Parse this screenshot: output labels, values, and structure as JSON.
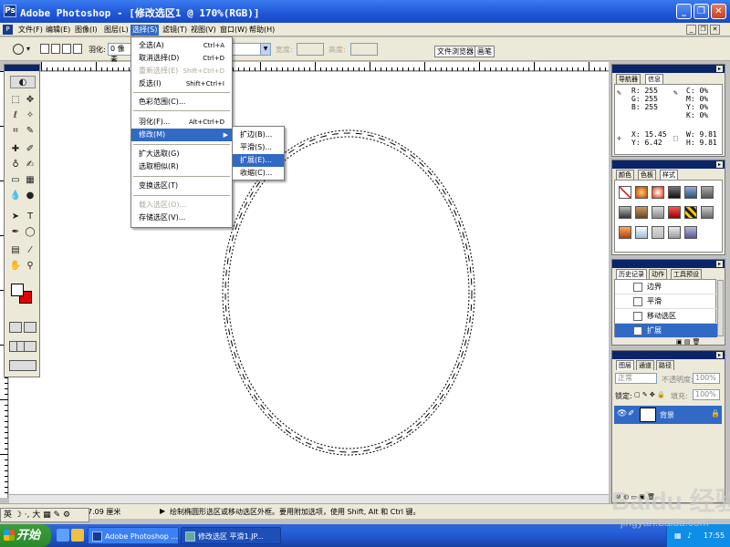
{
  "window": {
    "title": "Adobe Photoshop - [修改选区1 @ 170%(RGB)]"
  },
  "menubar": [
    "文件(F)",
    "编辑(E)",
    "图像(I)",
    "图层(L)",
    "选择(S)",
    "滤镜(T)",
    "视图(V)",
    "窗口(W)",
    "帮助(H)"
  ],
  "optionsbar": {
    "feather_label": "羽化:",
    "feather_value": "0 像素",
    "width_label": "宽度:",
    "height_label": "高度:",
    "tab_file_browser": "文件浏览器",
    "tab_brushes": "画笔"
  },
  "select_menu": {
    "items": [
      {
        "label": "全选(A)",
        "shortcut": "Ctrl+A"
      },
      {
        "label": "取消选择(D)",
        "shortcut": "Ctrl+D"
      },
      {
        "label": "重新选择(E)",
        "shortcut": "Shift+Ctrl+D"
      },
      {
        "label": "反选(I)",
        "shortcut": "Shift+Ctrl+I"
      },
      {
        "label": "色彩范围(C)..."
      },
      {
        "label": "羽化(F)...",
        "shortcut": "Alt+Ctrl+D"
      },
      {
        "label": "修改(M)"
      },
      {
        "label": "扩大选取(G)"
      },
      {
        "label": "选取相似(R)"
      },
      {
        "label": "变换选区(T)"
      },
      {
        "label": "载入选区(O)..."
      },
      {
        "label": "存储选区(V)..."
      }
    ]
  },
  "modify_submenu": [
    "扩边(B)...",
    "平滑(S)...",
    "扩展(E)...",
    "收缩(C)..."
  ],
  "navigator_panel": {
    "tabs": [
      "导航器",
      "信息"
    ],
    "info_lines_left": [
      "R:  255",
      "G:  255",
      "B:  255"
    ],
    "info_lines_right": [
      "C:  0%",
      "M:  0%",
      "Y:  0%",
      "K:  0%"
    ],
    "xy_left": [
      "X: 15.45",
      "Y:  6.42"
    ],
    "wh_right": [
      "W:  9.81",
      "H:  9.81"
    ]
  },
  "color_panel": {
    "tabs": [
      "颜色",
      "色板",
      "样式"
    ]
  },
  "history_panel": {
    "tabs": [
      "历史记录",
      "动作",
      "工具预设"
    ],
    "items": [
      "边界",
      "平滑",
      "移动选区",
      "扩展"
    ]
  },
  "layers_panel": {
    "tabs": [
      "图层",
      "通道",
      "路径"
    ],
    "mode": "正常",
    "opacity_label": "不透明度:",
    "opacity_value": "100%",
    "lock_label": "锁定:",
    "fill_label": "填充:",
    "fill_value": "100%",
    "layer_name": "背景"
  },
  "statusbar": {
    "doc_size": "7.09 厘米",
    "hint": "绘制椭圆形选区或移动选区外框。要用附加选项，使用 Shift, Alt 和 Ctrl 键。"
  },
  "ime": {
    "text": "英 ☽ ·, 大 ▦ ✎ ⚙"
  },
  "taskbar": {
    "start_label": "开始",
    "tasks": [
      "Adobe Photoshop ...",
      "修改选区 平滑1.JP..."
    ],
    "clock": "17:55"
  },
  "watermark": {
    "brand": "Baidu 经验",
    "url": "jingyan.baidu.com"
  },
  "colors": {
    "title_blue": "#1f56d8",
    "highlight": "#316ac5",
    "fg_color": "#ffffff",
    "bg_color": "#e00000"
  }
}
